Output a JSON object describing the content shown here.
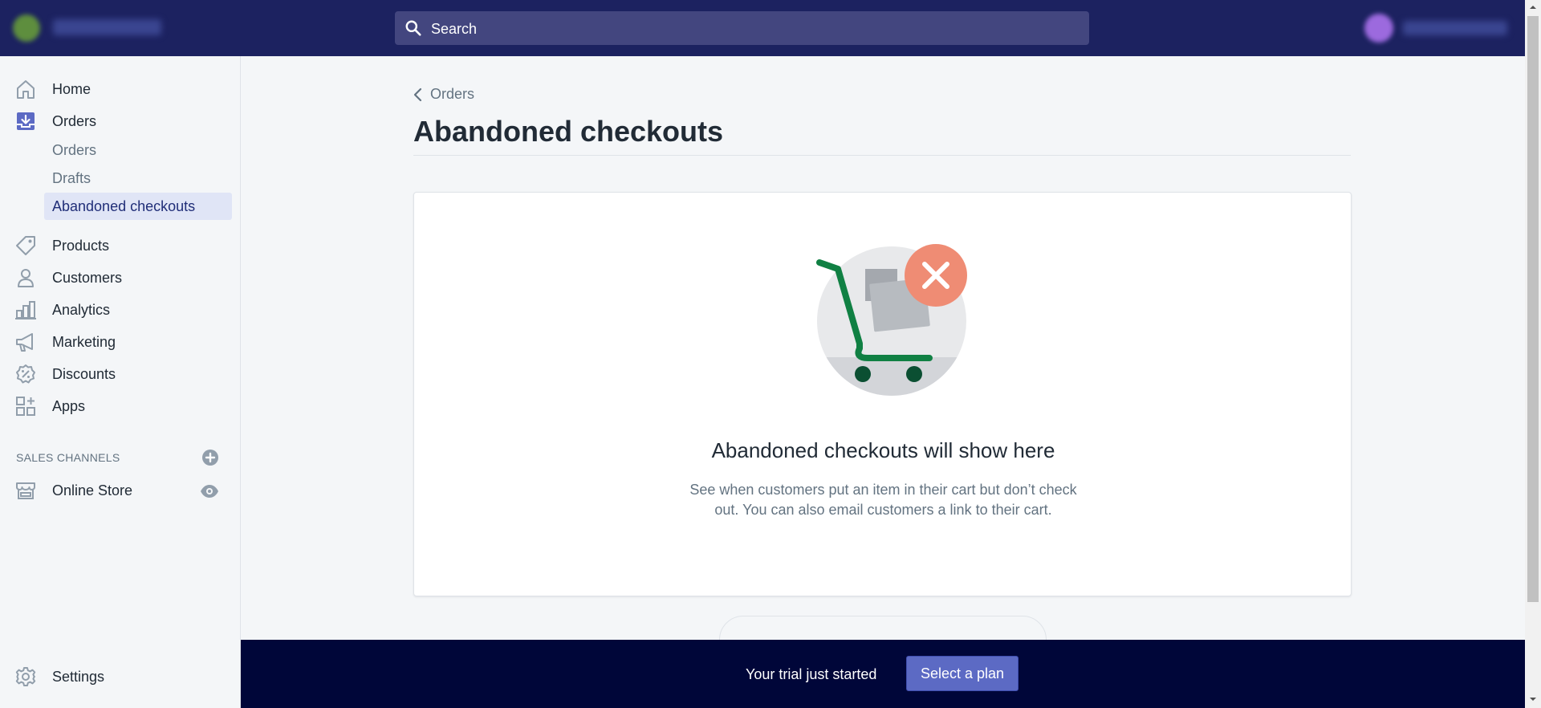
{
  "topbar": {
    "search_placeholder": "Search"
  },
  "sidebar": {
    "items": [
      {
        "label": "Home",
        "icon": "home-icon"
      },
      {
        "label": "Orders",
        "icon": "orders-icon"
      },
      {
        "label": "Products",
        "icon": "tag-icon"
      },
      {
        "label": "Customers",
        "icon": "person-icon"
      },
      {
        "label": "Analytics",
        "icon": "bar-chart-icon"
      },
      {
        "label": "Marketing",
        "icon": "megaphone-icon"
      },
      {
        "label": "Discounts",
        "icon": "discount-icon"
      },
      {
        "label": "Apps",
        "icon": "apps-icon"
      }
    ],
    "orders_sub": [
      {
        "label": "Orders"
      },
      {
        "label": "Drafts"
      },
      {
        "label": "Abandoned checkouts",
        "active": true
      }
    ],
    "sales_channels_title": "SALES CHANNELS",
    "online_store_label": "Online Store",
    "settings_label": "Settings"
  },
  "main": {
    "breadcrumb": "Orders",
    "title": "Abandoned checkouts",
    "empty_title": "Abandoned checkouts will show here",
    "empty_desc": "See when customers put an item in their cart but don’t check out. You can also email customers a link to their cart."
  },
  "banner": {
    "message": "Your trial just started",
    "button_label": "Select a plan"
  },
  "colors": {
    "topbar": "#1c2260",
    "banner": "#000639",
    "accent": "#5c6ac4",
    "active_bg": "#e0e5f6",
    "cart_green": "#108043",
    "x_badge": "#ef8c74"
  }
}
